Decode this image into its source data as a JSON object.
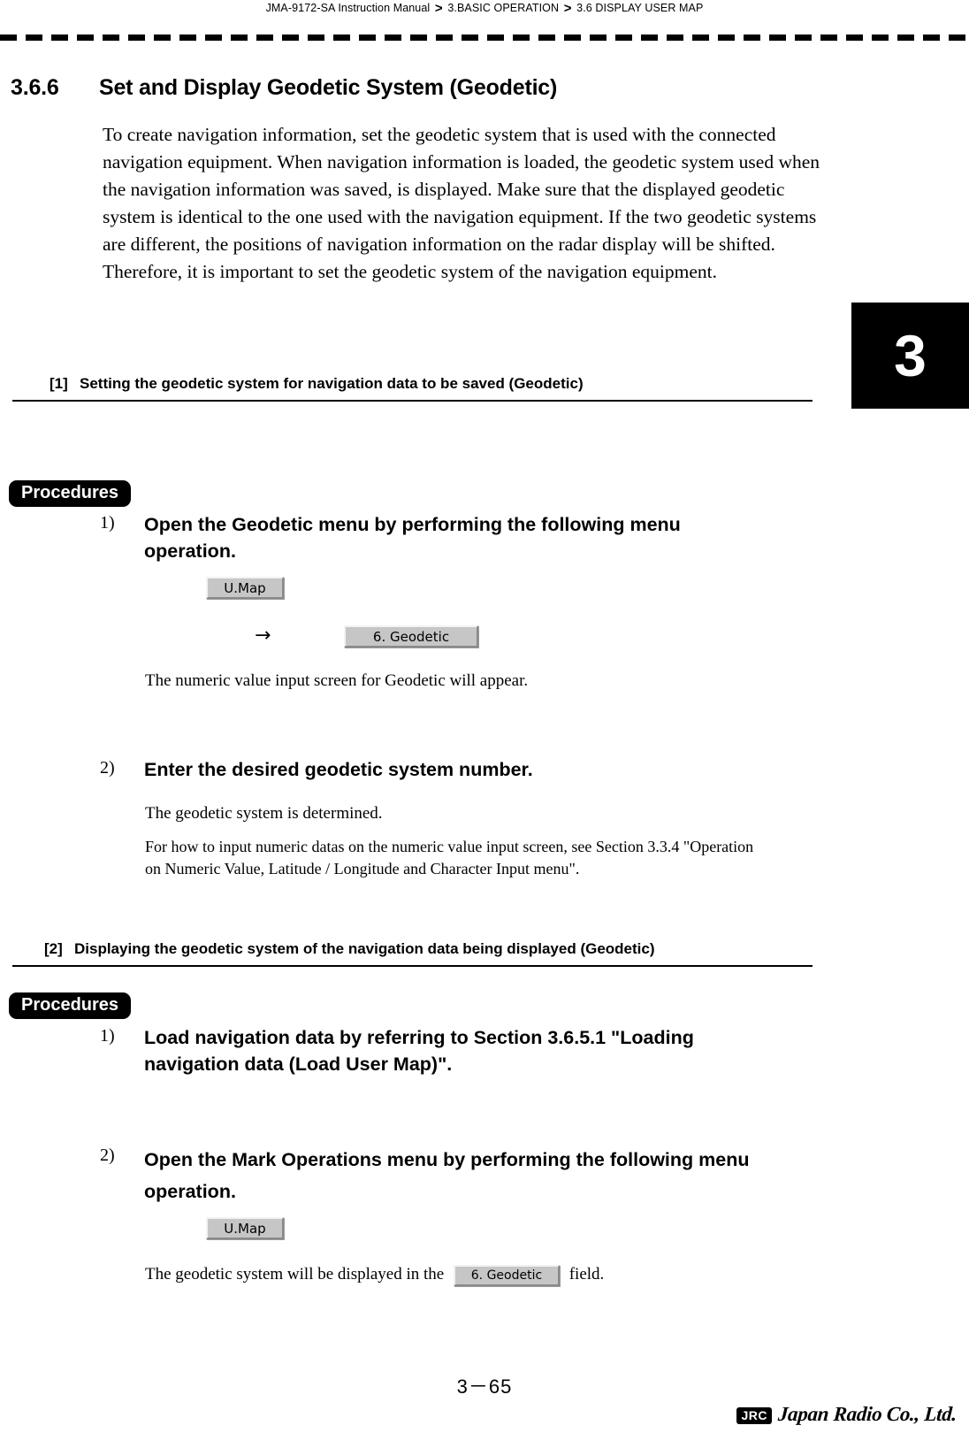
{
  "header": {
    "breadcrumb_parts": [
      "JMA-9172-SA Instruction Manual",
      "3.BASIC OPERATION",
      "3.6  DISPLAY USER MAP"
    ],
    "separator": ">"
  },
  "chapter_tab": {
    "label": "3"
  },
  "section": {
    "number": "3.6.6",
    "title": "Set and Display Geodetic System (Geodetic)",
    "intro": "To create navigation information, set the geodetic system that is used with the connected navigation equipment. When navigation information is loaded, the geodetic system used when the navigation information was saved, is displayed. Make sure that the displayed geodetic system is identical to the one used with the navigation equipment. If the two geodetic systems are different, the positions of navigation information on the radar display will be shifted. Therefore, it is important to set the geodetic system of the navigation equipment."
  },
  "block1": {
    "tag": "[1]",
    "heading": "Setting the geodetic system for navigation data to be saved (Geodetic)",
    "procedures_label": "Procedures",
    "step1_num": "1)",
    "step1_text": "Open the Geodetic menu by performing the following menu operation.",
    "button_umap": "U.Map",
    "arrow": "→",
    "button_geodetic": "6. Geodetic",
    "note1": "The numeric value input screen for Geodetic will appear.",
    "step2_num": "2)",
    "step2_text": "Enter the desired geodetic system number.",
    "note2": "The geodetic system is determined.",
    "note3": "For how to input numeric datas on the numeric value input screen, see Section 3.3.4 \"Operation on Numeric Value, Latitude / Longitude and Character Input menu\"."
  },
  "block2": {
    "tag": "[2]",
    "heading": "Displaying the geodetic system of the navigation data being displayed (Geodetic)",
    "procedures_label": "Procedures",
    "step1_num": "1)",
    "step1_text": "Load navigation data by referring to Section 3.6.5.1 \"Loading navigation data (Load User Map)\".",
    "step2_num": "2)",
    "step2_text": "Open the Mark Operations menu by performing the following menu operation.",
    "button_umap": "U.Map",
    "note_prefix": "The geodetic system will be displayed in the",
    "button_geodetic": "6. Geodetic",
    "note_suffix": "field."
  },
  "footer": {
    "page_number": "3－65",
    "logo_mark": "JRC",
    "logo_text": "Japan Radio Co., Ltd."
  }
}
